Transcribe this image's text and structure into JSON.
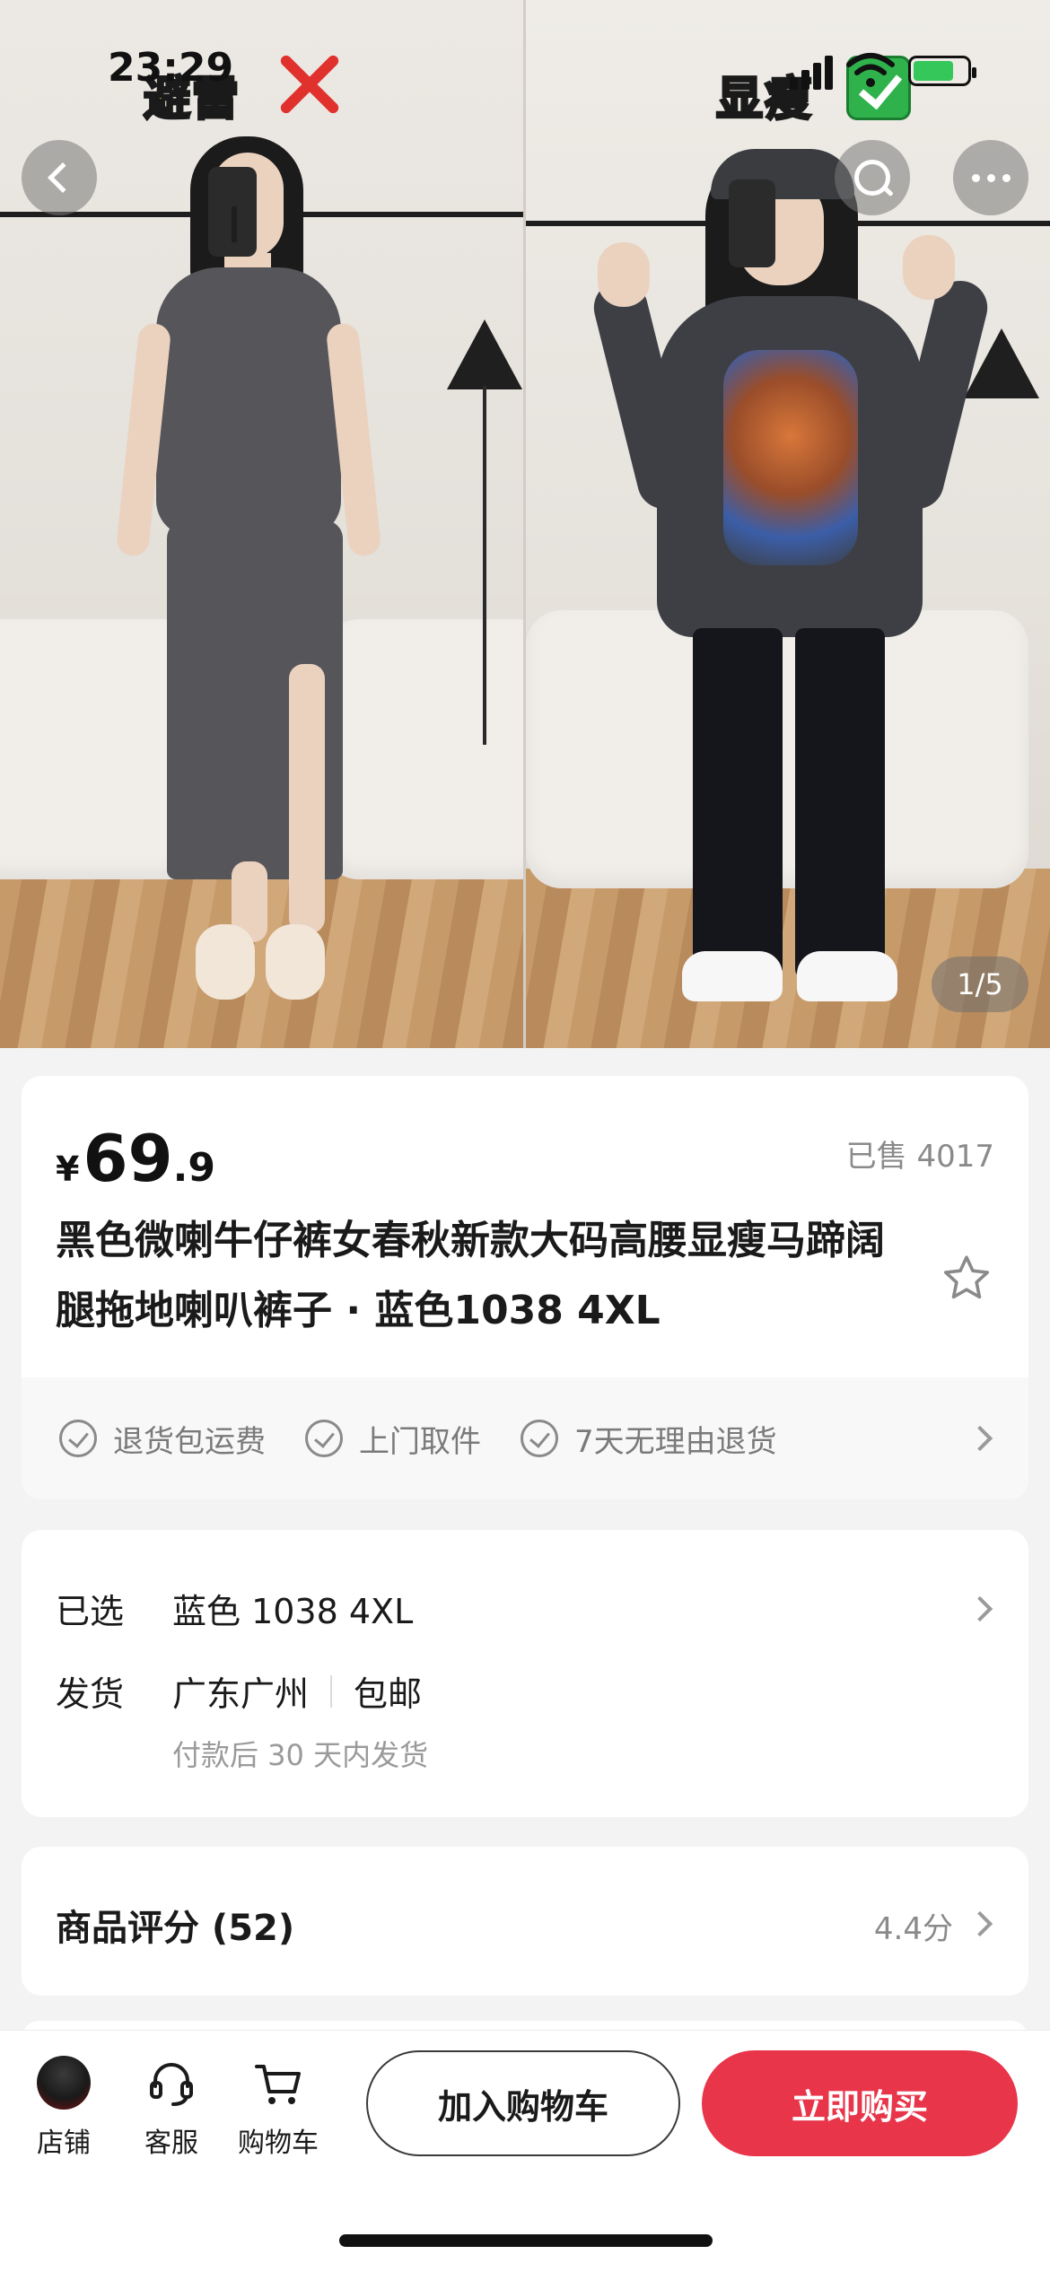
{
  "status_bar": {
    "time": "23:29"
  },
  "gallery": {
    "left_caption": "避雷",
    "right_caption": "显瘦",
    "page_counter": "1/5"
  },
  "product": {
    "currency": "¥",
    "price_integer": "69",
    "price_decimal": ".9",
    "sold": "已售 4017",
    "title": "黑色微喇牛仔裤女春秋新款大码高腰显瘦马蹄阔腿拖地喇叭裤子 · 蓝色1038 4XL",
    "guarantees": [
      "退货包运费",
      "上门取件",
      "7天无理由退货"
    ]
  },
  "spec": {
    "selected_label": "已选",
    "selected_value": "蓝色 1038 4XL",
    "shipping_label": "发货",
    "shipping_origin": "广东广州",
    "shipping_fee": "包邮",
    "shipping_note": "付款后 30 天内发货"
  },
  "rating": {
    "title": "商品评分 (52)",
    "score": "4.4分"
  },
  "bottom_bar": {
    "shop_label": "店铺",
    "service_label": "客服",
    "cart_label": "购物车",
    "add_to_cart": "加入购物车",
    "buy_now": "立即购买"
  },
  "colors": {
    "accent": "#e8354a",
    "price": "#111111",
    "muted": "#8a8a8a"
  }
}
